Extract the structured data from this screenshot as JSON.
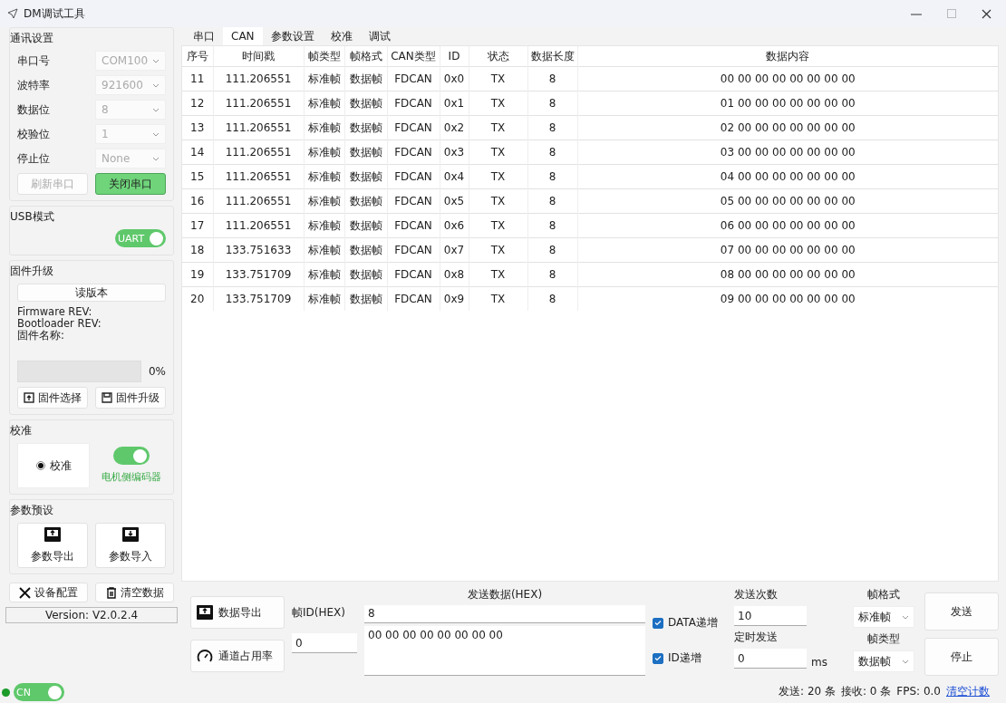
{
  "window": {
    "title": "DM调试工具"
  },
  "sidebar": {
    "comm": {
      "title": "通讯设置",
      "fields": [
        {
          "label": "串口号",
          "value": "COM100",
          "disabled": true
        },
        {
          "label": "波特率",
          "value": "921600",
          "disabled": true
        },
        {
          "label": "数据位",
          "value": "8",
          "disabled": true
        },
        {
          "label": "校验位",
          "value": "1",
          "disabled": true
        },
        {
          "label": "停止位",
          "value": "None",
          "disabled": true
        }
      ],
      "buttons": [
        {
          "label": "刷新串口",
          "kind": "plain",
          "disabled": true
        },
        {
          "label": "关闭串口",
          "kind": "accent",
          "disabled": false
        }
      ]
    },
    "usb": {
      "title": "USB模式",
      "toggle": {
        "label": "UART",
        "on": true
      }
    },
    "firmware": {
      "title": "固件升级",
      "read_button": "读版本",
      "info": [
        "Firmware  REV:",
        "Bootloader REV:",
        "固件名称:"
      ],
      "progress": {
        "level": 0,
        "reading": "0%"
      },
      "buttons": [
        {
          "label": "固件选择",
          "kind": "select"
        },
        {
          "label": "固件升级",
          "kind": "upgrade"
        }
      ]
    },
    "calibration": {
      "title": "校准",
      "radio": {
        "label": "校准",
        "selected": true
      },
      "toggle": {
        "label": "电机侧编码器",
        "on": true
      }
    },
    "params": {
      "title": "参数预设",
      "buttons": [
        {
          "label": "参数导出",
          "kind": "export"
        },
        {
          "label": "参数导入",
          "kind": "import"
        }
      ]
    },
    "footer_buttons": [
      {
        "label": "设备配置",
        "kind": "tools"
      },
      {
        "label": "清空数据",
        "kind": "trash"
      }
    ],
    "version": "Version: V2.0.2.4",
    "status_dot": {
      "color": "#1a9b2a"
    },
    "language_toggle": {
      "label": "CN",
      "on": true
    }
  },
  "tabs": [
    {
      "label": "串口",
      "selected": false
    },
    {
      "label": "CAN",
      "selected": true
    },
    {
      "label": "参数设置",
      "selected": false
    },
    {
      "label": "校准",
      "selected": false
    },
    {
      "label": "调试",
      "selected": false
    }
  ],
  "table": {
    "columns": [
      "序号",
      "时间戳",
      "帧类型",
      "帧格式",
      "CAN类型",
      "ID",
      "状态",
      "数据长度",
      "数据内容"
    ],
    "rows": [
      [
        "11",
        "111.206551",
        "标准帧",
        "数据帧",
        "FDCAN",
        "0x0",
        "TX",
        "8",
        "00 00 00 00 00 00 00 00"
      ],
      [
        "12",
        "111.206551",
        "标准帧",
        "数据帧",
        "FDCAN",
        "0x1",
        "TX",
        "8",
        "01 00 00 00 00 00 00 00"
      ],
      [
        "13",
        "111.206551",
        "标准帧",
        "数据帧",
        "FDCAN",
        "0x2",
        "TX",
        "8",
        "02 00 00 00 00 00 00 00"
      ],
      [
        "14",
        "111.206551",
        "标准帧",
        "数据帧",
        "FDCAN",
        "0x3",
        "TX",
        "8",
        "03 00 00 00 00 00 00 00"
      ],
      [
        "15",
        "111.206551",
        "标准帧",
        "数据帧",
        "FDCAN",
        "0x4",
        "TX",
        "8",
        "04 00 00 00 00 00 00 00"
      ],
      [
        "16",
        "111.206551",
        "标准帧",
        "数据帧",
        "FDCAN",
        "0x5",
        "TX",
        "8",
        "05 00 00 00 00 00 00 00"
      ],
      [
        "17",
        "111.206551",
        "标准帧",
        "数据帧",
        "FDCAN",
        "0x6",
        "TX",
        "8",
        "06 00 00 00 00 00 00 00"
      ],
      [
        "18",
        "133.751633",
        "标准帧",
        "数据帧",
        "FDCAN",
        "0x7",
        "TX",
        "8",
        "07 00 00 00 00 00 00 00"
      ],
      [
        "19",
        "133.751709",
        "标准帧",
        "数据帧",
        "FDCAN",
        "0x8",
        "TX",
        "8",
        "08 00 00 00 00 00 00 00"
      ],
      [
        "20",
        "133.751709",
        "标准帧",
        "数据帧",
        "FDCAN",
        "0x9",
        "TX",
        "8",
        "09 00 00 00 00 00 00 00"
      ]
    ]
  },
  "send_panel": {
    "export_button": "数据导出",
    "usage_button": "通道占用率",
    "frame_id_label": "帧ID(HEX)",
    "frame_id": "0",
    "data_title": "发送数据(HEX)",
    "length": "8",
    "data": "00 00 00 00 00 00 00 00",
    "checkboxes": [
      {
        "label": "DATA递增",
        "checked": true
      },
      {
        "label": "ID递增",
        "checked": true
      }
    ],
    "count_label": "发送次数",
    "count": "10",
    "timer_label": "定时发送",
    "timer": "0",
    "timer_unit": "ms",
    "format_label": "帧格式",
    "format": "标准帧",
    "type_label": "帧类型",
    "type": "数据帧",
    "send_button": "发送",
    "stop_button": "停止"
  },
  "status_bar": {
    "sent": "发送: 20 条",
    "received": "接收: 0 条",
    "fps": "FPS: 0.0",
    "clear_link": "清空计数"
  }
}
